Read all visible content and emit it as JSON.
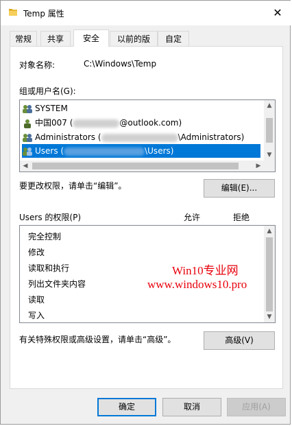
{
  "window": {
    "title": "Temp 属性",
    "close_label": "✕"
  },
  "tabs": [
    {
      "label": "常规"
    },
    {
      "label": "共享"
    },
    {
      "label": "安全",
      "active": true
    },
    {
      "label": "以前的版本"
    },
    {
      "label": "自定义"
    }
  ],
  "object": {
    "label": "对象名称:",
    "value": "C:\\Windows\\Temp"
  },
  "groups": {
    "label": "组或用户名(G):",
    "items": [
      {
        "name": "SYSTEM",
        "suffix": ""
      },
      {
        "name": "中国007 (",
        "suffix": "@outlook.com)"
      },
      {
        "name": "Administrators (",
        "suffix": "\\Administrators)"
      },
      {
        "name": "Users (",
        "suffix": "\\Users)"
      }
    ]
  },
  "edit_hint": "要更改权限，请单击“编辑”。",
  "edit_button": "编辑(E)...",
  "permissions": {
    "label": "Users 的权限(P)",
    "allow_header": "允许",
    "deny_header": "拒绝",
    "items": [
      "完全控制",
      "修改",
      "读取和执行",
      "列出文件夹内容",
      "读取",
      "写入"
    ]
  },
  "watermark": {
    "line1": "Win10专业网",
    "line2": "www.windows10.pro"
  },
  "advanced_hint": "有关特殊权限或高级设置，请单击“高级”。",
  "advanced_button": "高级(V)",
  "footer": {
    "ok": "确定",
    "cancel": "取消",
    "apply": "应用(A)"
  },
  "colors": {
    "selection": "#0078d7",
    "watermark": "#e8000b"
  }
}
